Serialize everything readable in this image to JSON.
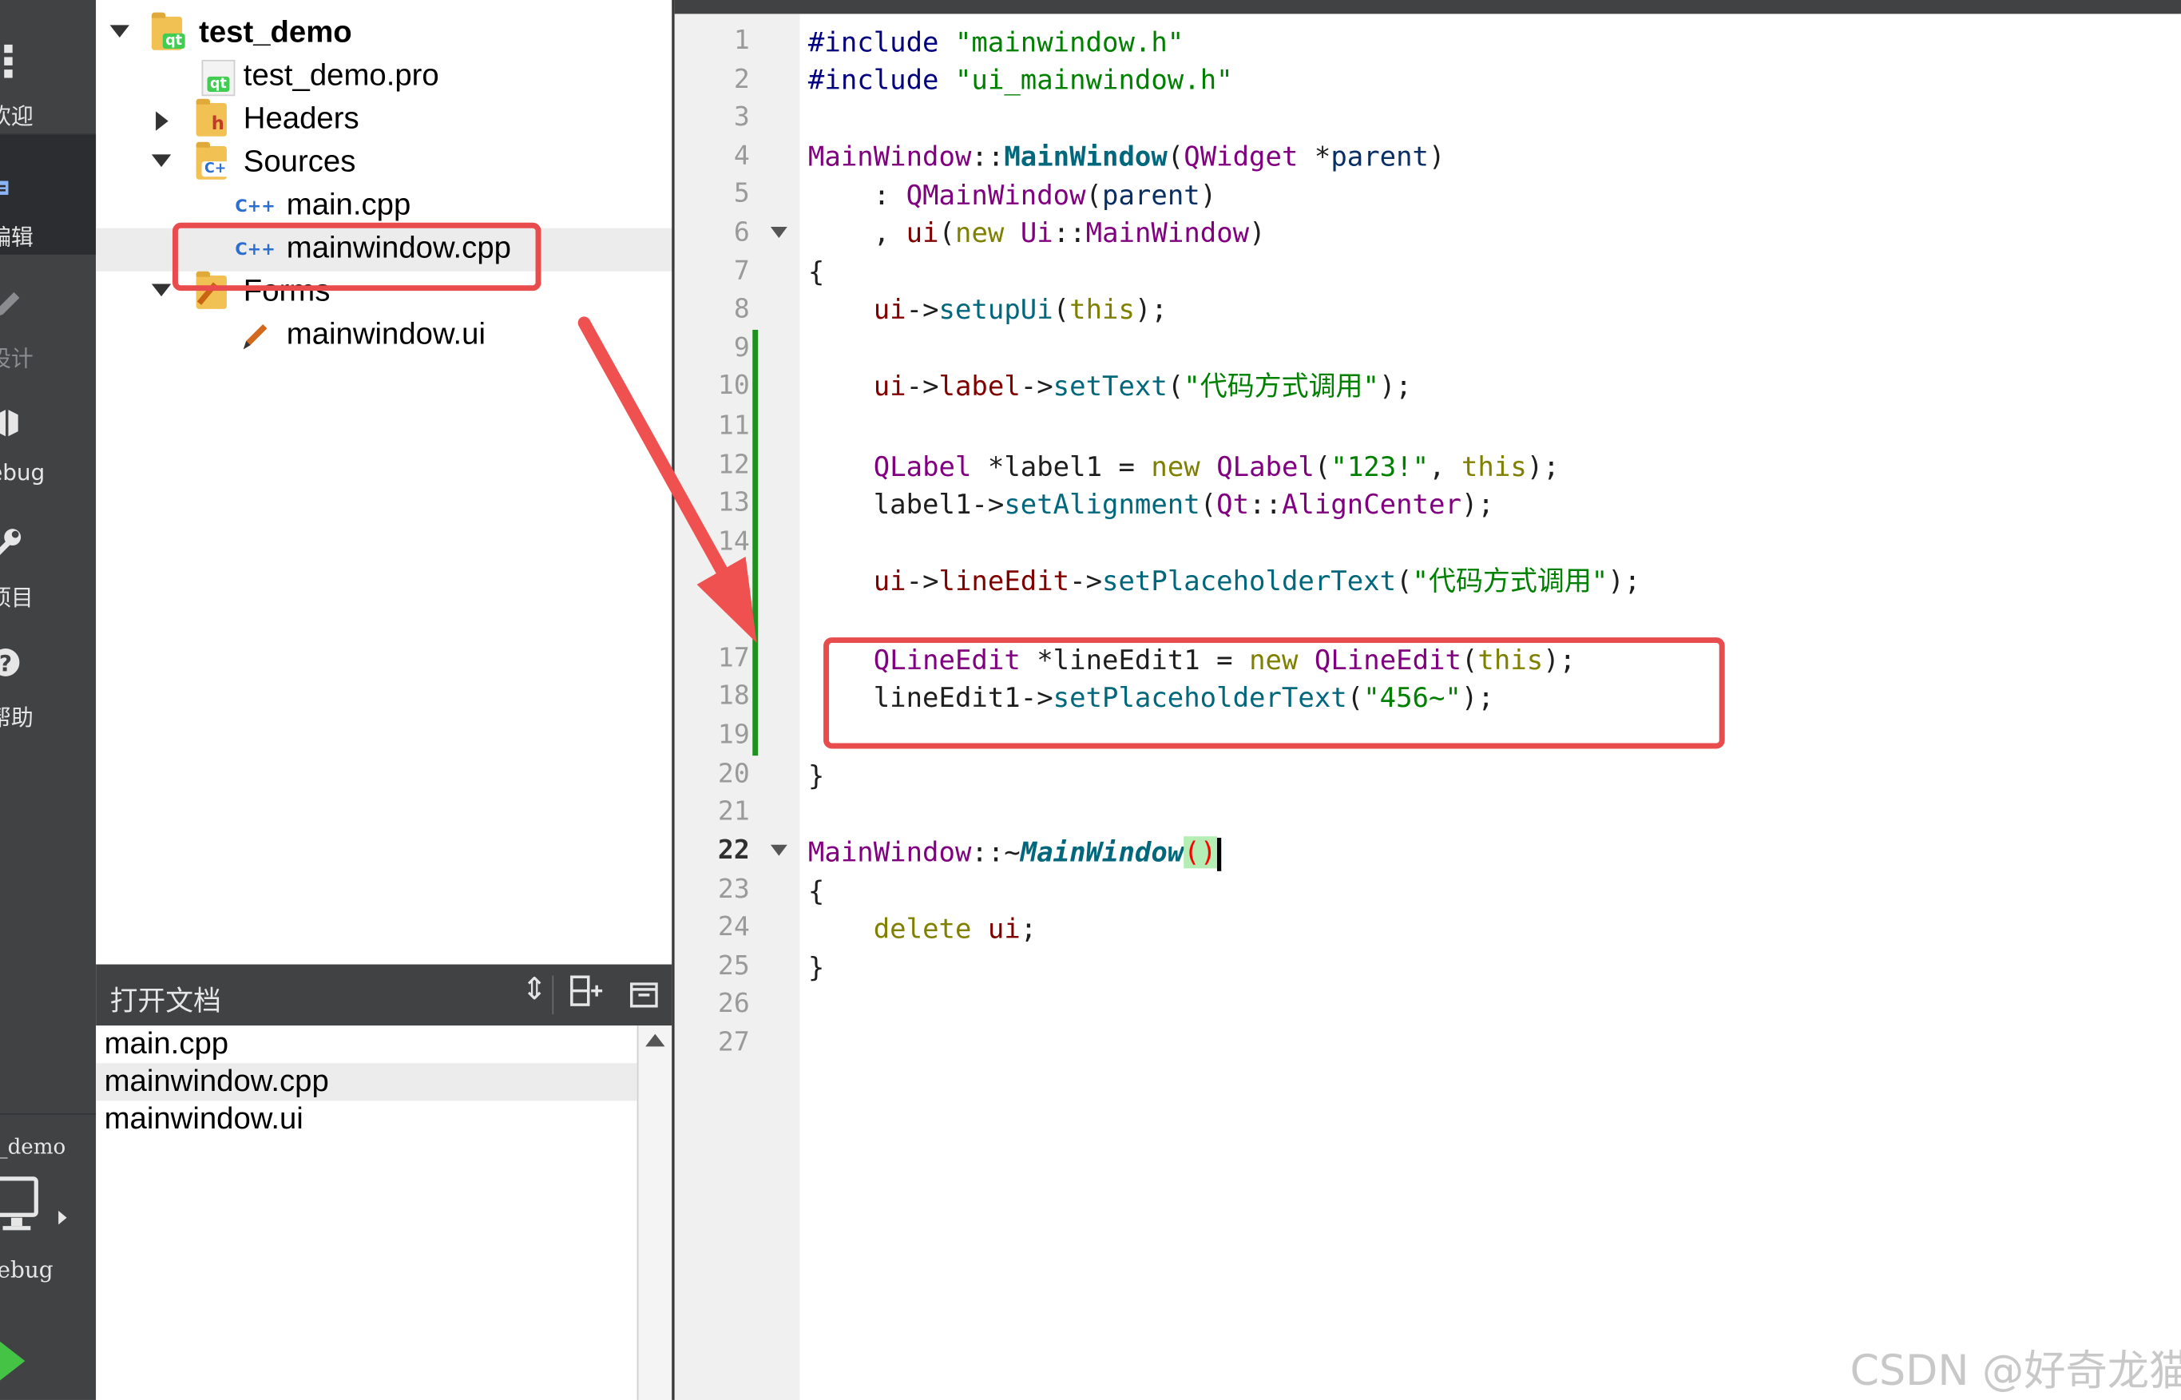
{
  "mode_bar": {
    "items": [
      {
        "label": "欢迎",
        "icon": "grid-icon",
        "state": "normal"
      },
      {
        "label": "编辑",
        "icon": "edit-doc-icon",
        "state": "active"
      },
      {
        "label": "设计",
        "icon": "pencil-icon",
        "state": "disabled"
      },
      {
        "label": "ebug",
        "icon": "bug-icon",
        "state": "normal"
      },
      {
        "label": "项目",
        "icon": "wrench-icon",
        "state": "normal"
      },
      {
        "label": "帮助",
        "icon": "help-icon",
        "state": "normal"
      }
    ],
    "project_label": "_demo",
    "kit_label": "ebug"
  },
  "project_tree": {
    "root": "test_demo",
    "pro_file": "test_demo.pro",
    "headers": "Headers",
    "sources": "Sources",
    "main_cpp": "main.cpp",
    "mainwindow_cpp": "mainwindow.cpp",
    "forms": "Forms",
    "mainwindow_ui": "mainwindow.ui",
    "cpp_badge": "C++"
  },
  "open_documents": {
    "title": "打开文档",
    "files": [
      "main.cpp",
      "mainwindow.cpp",
      "mainwindow.ui"
    ]
  },
  "editor": {
    "line_numbers": [
      "1",
      "2",
      "3",
      "4",
      "5",
      "6",
      "7",
      "8",
      "9",
      "10",
      "11",
      "12",
      "13",
      "14",
      "",
      "",
      "17",
      "18",
      "19",
      "20",
      "21",
      "22",
      "23",
      "24",
      "25",
      "26",
      "27"
    ],
    "current_line": 22,
    "strings": {
      "include1": "\"mainwindow.h\"",
      "include2": "\"ui_mainwindow.h\"",
      "label_text": "\"代码方式调用\"",
      "label1_text": "\"123!\"",
      "placeholder1": "\"代码方式调用\"",
      "placeholder2": "\"456~\""
    }
  },
  "watermark": "CSDN @好奇龙猫",
  "colors": {
    "annotation": "#e84c4c",
    "change_marker": "#1f8f1f"
  }
}
